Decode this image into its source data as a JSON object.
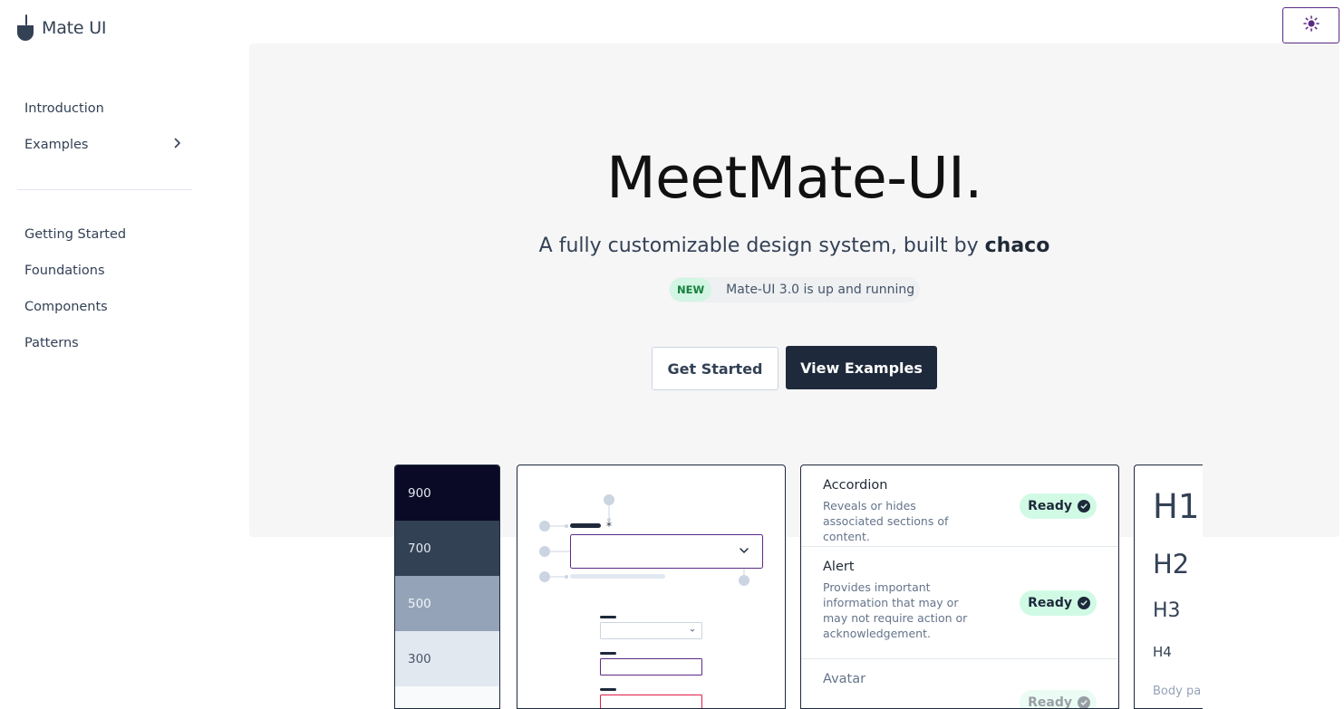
{
  "brand": {
    "name": "Mate UI"
  },
  "theme_toggle": {
    "icon": "sun-icon"
  },
  "nav": {
    "primary": [
      {
        "label": "Introduction"
      },
      {
        "label": "Examples",
        "icon": "chevron-right-icon"
      }
    ],
    "secondary": [
      {
        "label": "Getting Started"
      },
      {
        "label": "Foundations"
      },
      {
        "label": "Components"
      },
      {
        "label": "Patterns"
      }
    ]
  },
  "hero": {
    "title": "MeetMate-UI.",
    "subtitle": "A fully customizable design system, built by ",
    "subtitle_author": "chaco",
    "badge": "NEW",
    "announcement": "Mate-UI 3.0 is up and running",
    "primary_cta": "Get Started",
    "secondary_cta": "View Examples"
  },
  "swatches": [
    {
      "label": "900",
      "color": "#0b0a26",
      "text_color": "#e2e8f0"
    },
    {
      "label": "700",
      "color": "#334155",
      "text_color": "#e2e8f0"
    },
    {
      "label": "500",
      "color": "#94a3b8",
      "text_color": "#f1f5f9"
    },
    {
      "label": "300",
      "color": "#e2e8f0",
      "text_color": "#475569"
    },
    {
      "label": "",
      "color": "#f8fafc",
      "text_color": "#475569"
    }
  ],
  "components": [
    {
      "name": "Accordion",
      "description": "Reveals or hides associated sections of content.",
      "status": "Ready"
    },
    {
      "name": "Alert",
      "description": "Provides important information that may or may not require action or acknowledgement.",
      "status": "Ready"
    },
    {
      "name": "Avatar",
      "description": "",
      "status": "Ready"
    }
  ],
  "typography": {
    "h1": "H1",
    "h2": "H2",
    "h3": "H3",
    "h4": "H4",
    "body": "Body pa"
  },
  "colors": {
    "accent": "#5b2a86",
    "dark": "#1e293b",
    "success_bg": "#d1fae5",
    "success_text": "#15803d",
    "hero_bg": "#f6f6f7"
  }
}
